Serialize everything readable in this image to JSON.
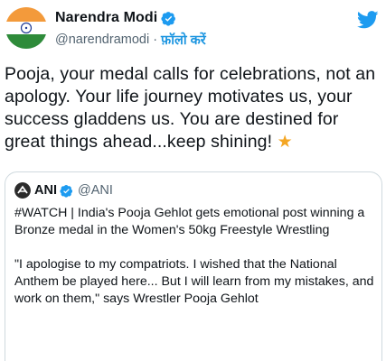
{
  "tweet": {
    "author": {
      "display_name": "Narendra Modi",
      "handle": "@narendramodi",
      "separator": "·",
      "follow_label": "फ़ॉलो करें",
      "avatar_icon": "india-flag-avatar-icon",
      "verified_icon": "verified-badge-icon"
    },
    "text": "Pooja, your medal calls for celebrations, not an apology. Your life journey motivates us, your success gladdens us. You are destined for great things ahead...keep shining!",
    "emoji": "★",
    "logo_icon": "twitter-bird-icon"
  },
  "quoted_tweet": {
    "author": {
      "display_name": "ANI",
      "handle": "@ANI",
      "avatar_icon": "ani-logo-icon",
      "verified_icon": "verified-badge-icon"
    },
    "paragraph_1": "#WATCH | India's Pooja Gehlot gets emotional post winning a Bronze medal in the Women's 50kg Freestyle Wrestling",
    "paragraph_2": "\"I apologise to my compatriots. I wished that the National Anthem be played here... But I will learn from my mistakes, and work on them,\" says Wrestler Pooja Gehlot"
  },
  "colors": {
    "verified_blue": "#1d9bf0",
    "follow_blue": "#1b95e0",
    "secondary_text": "#536471",
    "star": "#f4a623"
  }
}
